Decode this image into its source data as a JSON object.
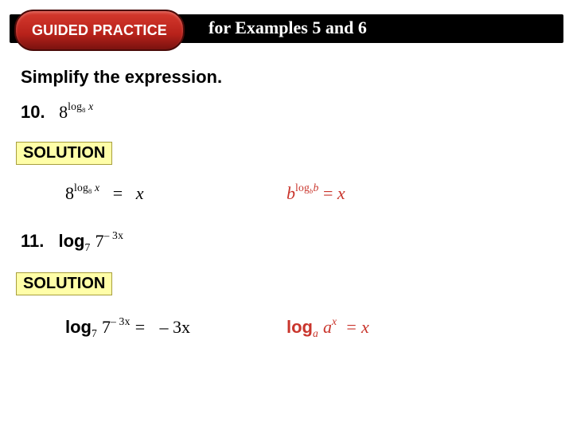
{
  "header": {
    "badge": "GUIDED PRACTICE",
    "title": "for Examples 5 and 6"
  },
  "instruction": "Simplify the expression.",
  "solution_label": "SOLUTION",
  "q10": {
    "number": "10.",
    "expr_base": "8",
    "expr_sup_log": "log",
    "expr_sup_sub": "8",
    "expr_sup_var": "x",
    "eq_equals": "=",
    "eq_result": "x",
    "rule_b1": "b",
    "rule_sup_log": "log",
    "rule_sup_sub": "b",
    "rule_sup_var": "b",
    "rule_equals": "=",
    "rule_rhs": "x"
  },
  "q11": {
    "number": "11.",
    "log_word": "log",
    "log_sub": "7",
    "arg_base": "7",
    "arg_exp": "– 3x",
    "eq_equals": "=",
    "eq_result": "– 3x",
    "rule_log": "log",
    "rule_sub": "a",
    "rule_arg_base": "a",
    "rule_arg_exp": "x",
    "rule_equals": "=",
    "rule_rhs": "x"
  }
}
